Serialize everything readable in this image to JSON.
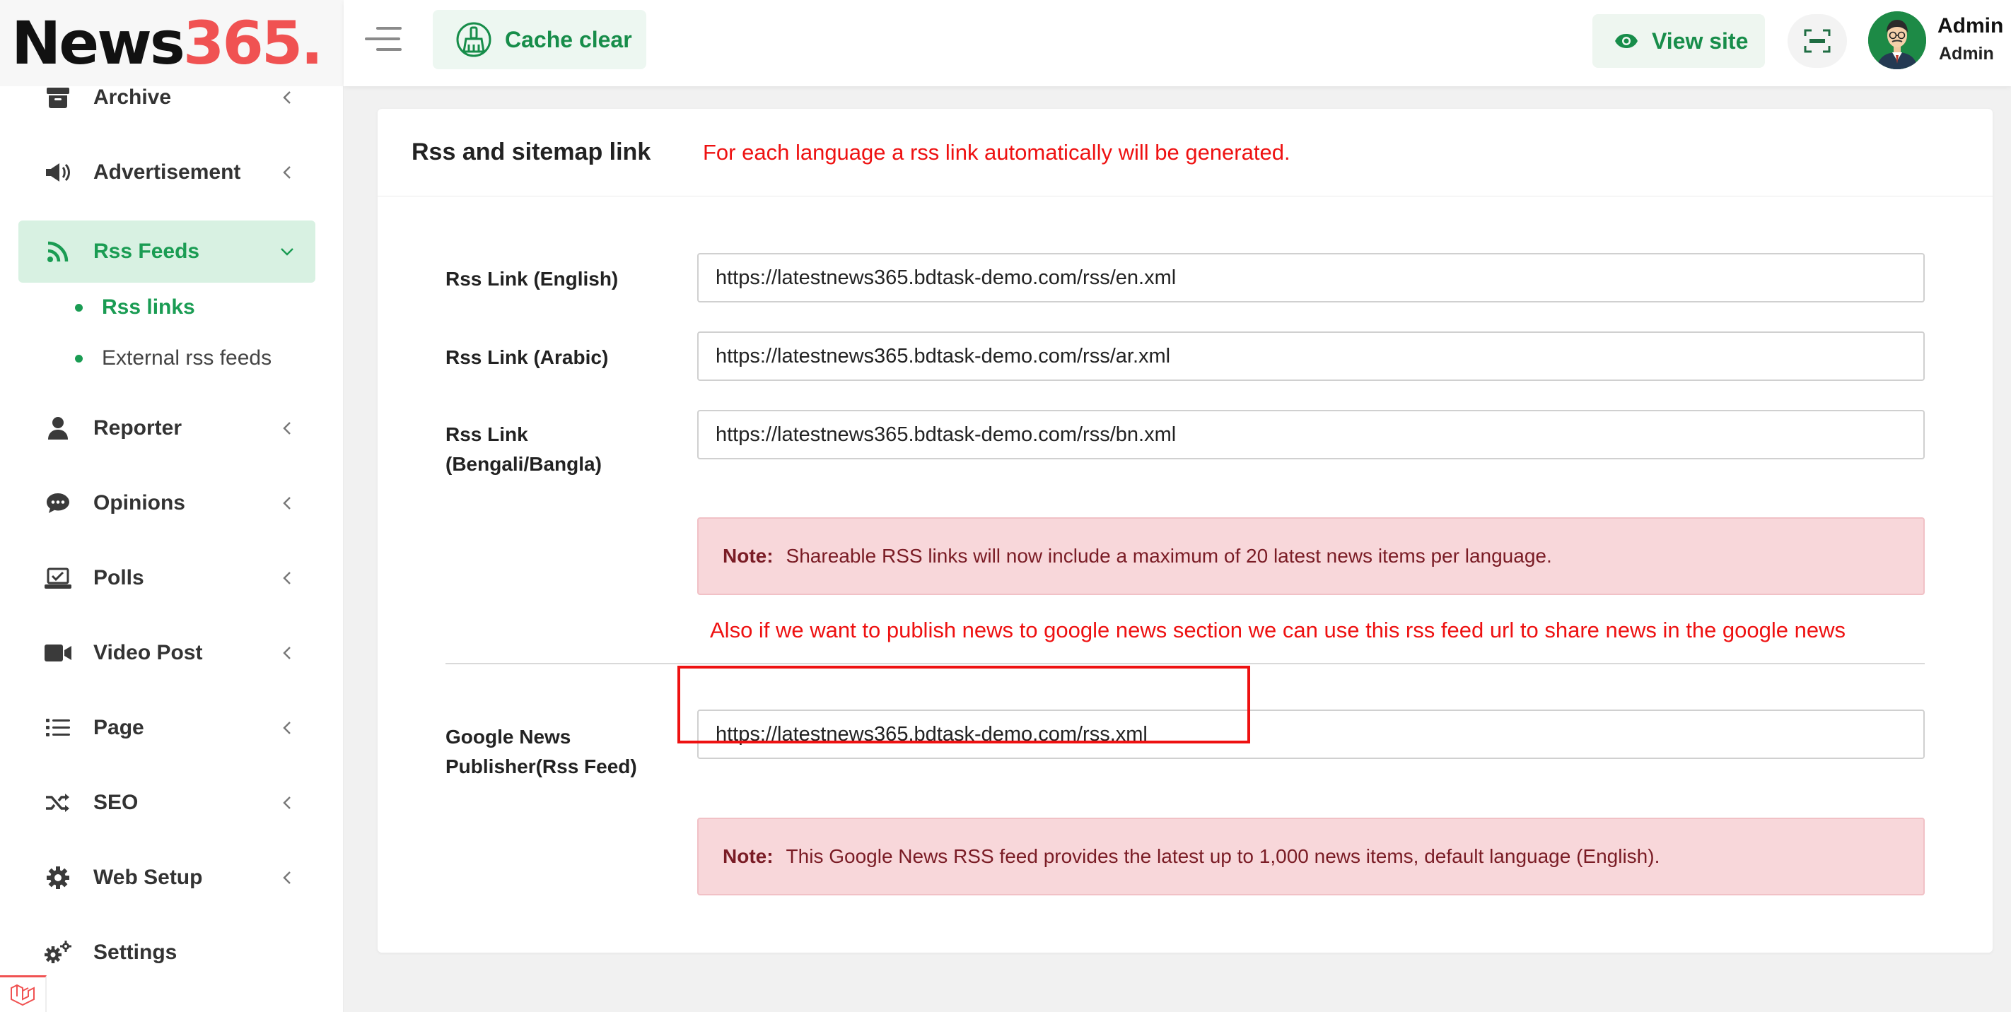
{
  "brand": {
    "logo_part1": "News",
    "logo_part2": "365."
  },
  "sidebar": {
    "items": [
      {
        "label": "Archive",
        "icon": "archive-icon"
      },
      {
        "label": "Advertisement",
        "icon": "megaphone-icon"
      },
      {
        "label": "Rss Feeds",
        "icon": "rss-icon",
        "active": true,
        "children": [
          {
            "label": "Rss links",
            "active": true
          },
          {
            "label": "External rss feeds"
          }
        ]
      },
      {
        "label": "Reporter",
        "icon": "user-icon"
      },
      {
        "label": "Opinions",
        "icon": "chat-icon"
      },
      {
        "label": "Polls",
        "icon": "poll-icon"
      },
      {
        "label": "Video Post",
        "icon": "video-icon"
      },
      {
        "label": "Page",
        "icon": "list-icon"
      },
      {
        "label": "SEO",
        "icon": "shuffle-icon"
      },
      {
        "label": "Web Setup",
        "icon": "gear-icon"
      },
      {
        "label": "Settings",
        "icon": "gears-icon"
      }
    ]
  },
  "header": {
    "cache_label": "Cache clear",
    "view_site_label": "View site",
    "user_name": "Admin",
    "user_role": "Admin"
  },
  "card": {
    "title": "Rss and sitemap link",
    "annotation_top": "For each language a rss link automatically will be generated.",
    "rows": [
      {
        "label": "Rss Link (English)",
        "value": "https://latestnews365.bdtask-demo.com/rss/en.xml"
      },
      {
        "label": "Rss Link (Arabic)",
        "value": "https://latestnews365.bdtask-demo.com/rss/ar.xml"
      },
      {
        "label_line1": "Rss Link",
        "label_line2": "(Bengali/Bangla)",
        "value": "https://latestnews365.bdtask-demo.com/rss/bn.xml"
      }
    ],
    "note1": {
      "label": "Note:",
      "text": "Shareable RSS links will now include a maximum of 20 latest news items per language."
    },
    "annotation_mid": "Also if we want to publish news to google news section we can use this rss feed url to share news in the google news",
    "google": {
      "label_line1": "Google News",
      "label_line2": "Publisher(Rss Feed)",
      "value": "https://latestnews365.bdtask-demo.com/rss.xml"
    },
    "note2": {
      "label": "Note:",
      "text": "This Google News RSS feed provides the latest up to 1,000 news items, default language (English)."
    }
  },
  "colors": {
    "accent_green": "#1a9c53",
    "active_bg": "#d8f1e2",
    "annotation_red": "#ee1111",
    "note_bg": "#f8d7da",
    "logo_red": "#f05252"
  }
}
